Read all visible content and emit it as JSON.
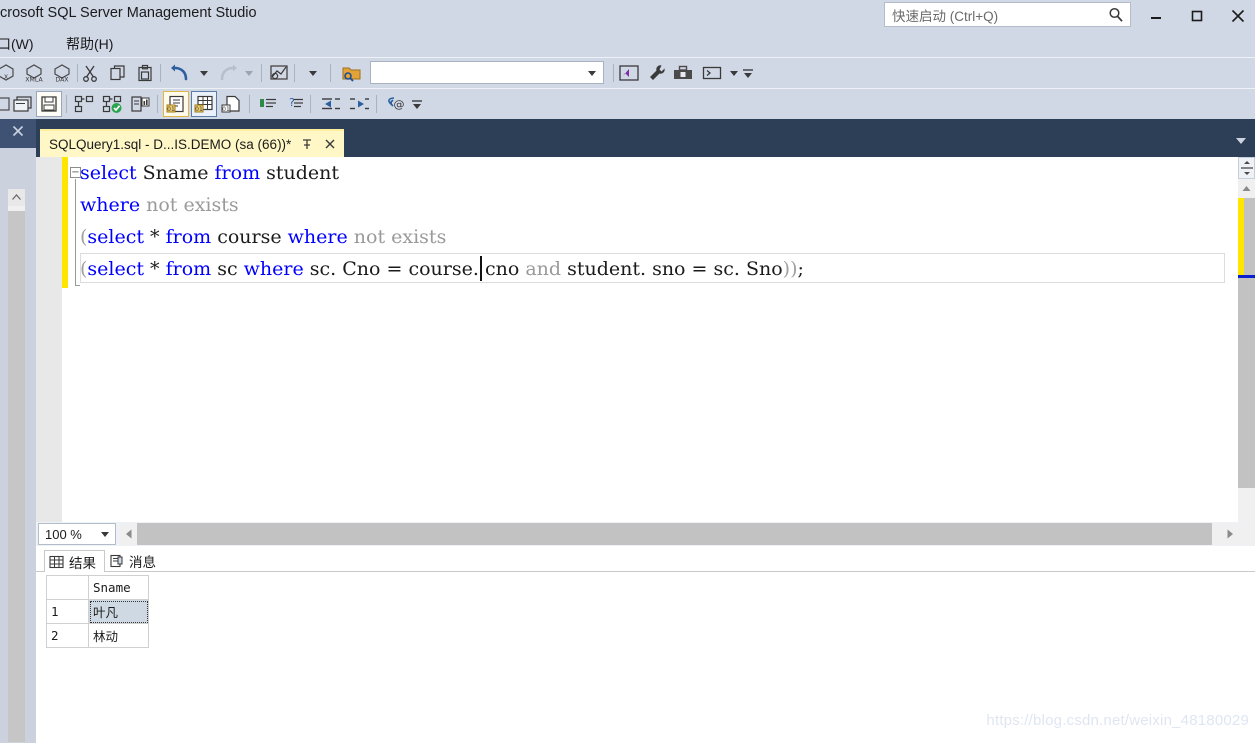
{
  "window": {
    "title": "crosoft SQL Server Management Studio",
    "quick_launch_placeholder": "快速启动 (Ctrl+Q)",
    "search_icon": "search-icon",
    "minimize_label": "—",
    "maximize_label": "□",
    "close_label": "✕"
  },
  "menubar": {
    "items": [
      {
        "label": "口(W)",
        "name": "menu-window"
      },
      {
        "label": "帮助(H)",
        "name": "menu-help"
      }
    ]
  },
  "toolbar1": {
    "combo_value": "",
    "buttons": [
      {
        "name": "new-mdx-query-button",
        "icon": "mdx-query-icon"
      },
      {
        "name": "new-xmla-query-button",
        "icon": "xmla-query-icon"
      },
      {
        "name": "new-dax-query-button",
        "icon": "dax-query-icon"
      },
      {
        "name": "cut-button",
        "icon": "scissors-icon"
      },
      {
        "name": "copy-button",
        "icon": "copy-icon"
      },
      {
        "name": "paste-button",
        "icon": "paste-icon"
      },
      {
        "name": "undo-button",
        "icon": "undo-arrow-icon"
      },
      {
        "name": "undo-dropdown-button",
        "icon": "chevron-down-icon"
      },
      {
        "name": "redo-button",
        "icon": "redo-arrow-icon"
      },
      {
        "name": "redo-dropdown-button",
        "icon": "chevron-down-icon"
      },
      {
        "name": "navigate-backward-button",
        "icon": "window-arrow-icon"
      },
      {
        "name": "toolbar-options-dropdown",
        "icon": "chevron-down-icon"
      },
      {
        "name": "open-file-button",
        "icon": "folder-search-icon"
      },
      {
        "name": "visual-studio-button",
        "icon": "vs-window-icon"
      },
      {
        "name": "properties-button",
        "icon": "wrench-icon"
      },
      {
        "name": "toolbox-button",
        "icon": "toolbox-icon"
      },
      {
        "name": "command-prompt-button",
        "icon": "console-icon"
      },
      {
        "name": "command-prompt-dropdown",
        "icon": "chevron-down-icon"
      },
      {
        "name": "toolbar-overflow-button",
        "icon": "overflow-chevron-icon"
      }
    ]
  },
  "toolbar2": {
    "buttons": [
      {
        "name": "new-query-window-button",
        "icon": "window-stack-icon"
      },
      {
        "name": "save-button",
        "icon": "save-disk-icon"
      },
      {
        "name": "connect-button",
        "icon": "connect-node-icon"
      },
      {
        "name": "connect-ok-button",
        "icon": "connect-check-icon"
      },
      {
        "name": "database-server-button",
        "icon": "server-chart-icon"
      },
      {
        "name": "results-to-text-button",
        "icon": "results-text-icon"
      },
      {
        "name": "results-to-grid-button",
        "icon": "results-grid-icon"
      },
      {
        "name": "results-to-file-button",
        "icon": "results-file-icon"
      },
      {
        "name": "comment-lines-button",
        "icon": "comment-lines-icon"
      },
      {
        "name": "uncomment-lines-button",
        "icon": "uncomment-lines-icon"
      },
      {
        "name": "decrease-indent-button",
        "icon": "outdent-icon"
      },
      {
        "name": "increase-indent-button",
        "icon": "indent-icon"
      },
      {
        "name": "toggle-word-wrap-button",
        "icon": "at-arrow-icon"
      },
      {
        "name": "toolbar-overflow-button",
        "icon": "overflow-chevron-icon"
      }
    ]
  },
  "left_panel": {
    "close_label": "✕",
    "scroll_up_label": "⌃"
  },
  "editor_tab": {
    "label": "SQLQuery1.sql - D...IS.DEMO (sa (66))*",
    "pin_label": "⤓",
    "close_label": "✕",
    "tabstrip_menu_label": "▼"
  },
  "editor": {
    "collapse_glyph": "−",
    "lines": [
      [
        {
          "t": "select",
          "c": "kw"
        },
        {
          "t": " Sname ",
          "c": ""
        },
        {
          "t": "from",
          "c": "kw"
        },
        {
          "t": " student",
          "c": ""
        }
      ],
      [
        {
          "t": "where",
          "c": "kw"
        },
        {
          "t": " ",
          "c": ""
        },
        {
          "t": "not exists",
          "c": "gray"
        }
      ],
      [
        {
          "t": "(",
          "c": "paren"
        },
        {
          "t": "select",
          "c": "kw"
        },
        {
          "t": " * ",
          "c": ""
        },
        {
          "t": "from",
          "c": "kw"
        },
        {
          "t": " course ",
          "c": ""
        },
        {
          "t": "where",
          "c": "kw"
        },
        {
          "t": " ",
          "c": ""
        },
        {
          "t": "not exists",
          "c": "gray"
        }
      ],
      [
        {
          "t": "(",
          "c": "paren"
        },
        {
          "t": "select",
          "c": "kw"
        },
        {
          "t": " * ",
          "c": ""
        },
        {
          "t": "from",
          "c": "kw"
        },
        {
          "t": " sc ",
          "c": ""
        },
        {
          "t": "where",
          "c": "kw"
        },
        {
          "t": " sc. Cno = course. cno ",
          "c": ""
        },
        {
          "t": "and",
          "c": "gray"
        },
        {
          "t": " student. sno = sc. Sno",
          "c": ""
        },
        {
          "t": "))",
          "c": "paren"
        },
        {
          "t": ";",
          "c": ""
        }
      ]
    ]
  },
  "zoom_bar": {
    "zoom_value": "100 %",
    "zoom_dropdown_icon": "chevron-down-icon",
    "scroll_left_icon": "triangle-left-icon",
    "scroll_right_icon": "triangle-right-icon"
  },
  "results": {
    "tabs": [
      {
        "label": "结果",
        "icon": "grid-icon",
        "active": true,
        "name": "tab-results"
      },
      {
        "label": "消息",
        "icon": "message-icon",
        "active": false,
        "name": "tab-messages"
      }
    ],
    "columns": [
      "",
      "Sname"
    ],
    "rows": [
      {
        "num": "1",
        "values": [
          "叶凡"
        ],
        "selected": true
      },
      {
        "num": "2",
        "values": [
          "林动"
        ],
        "selected": false
      }
    ]
  },
  "watermark": {
    "text": "https://blog.csdn.net/weixin_48180029"
  }
}
